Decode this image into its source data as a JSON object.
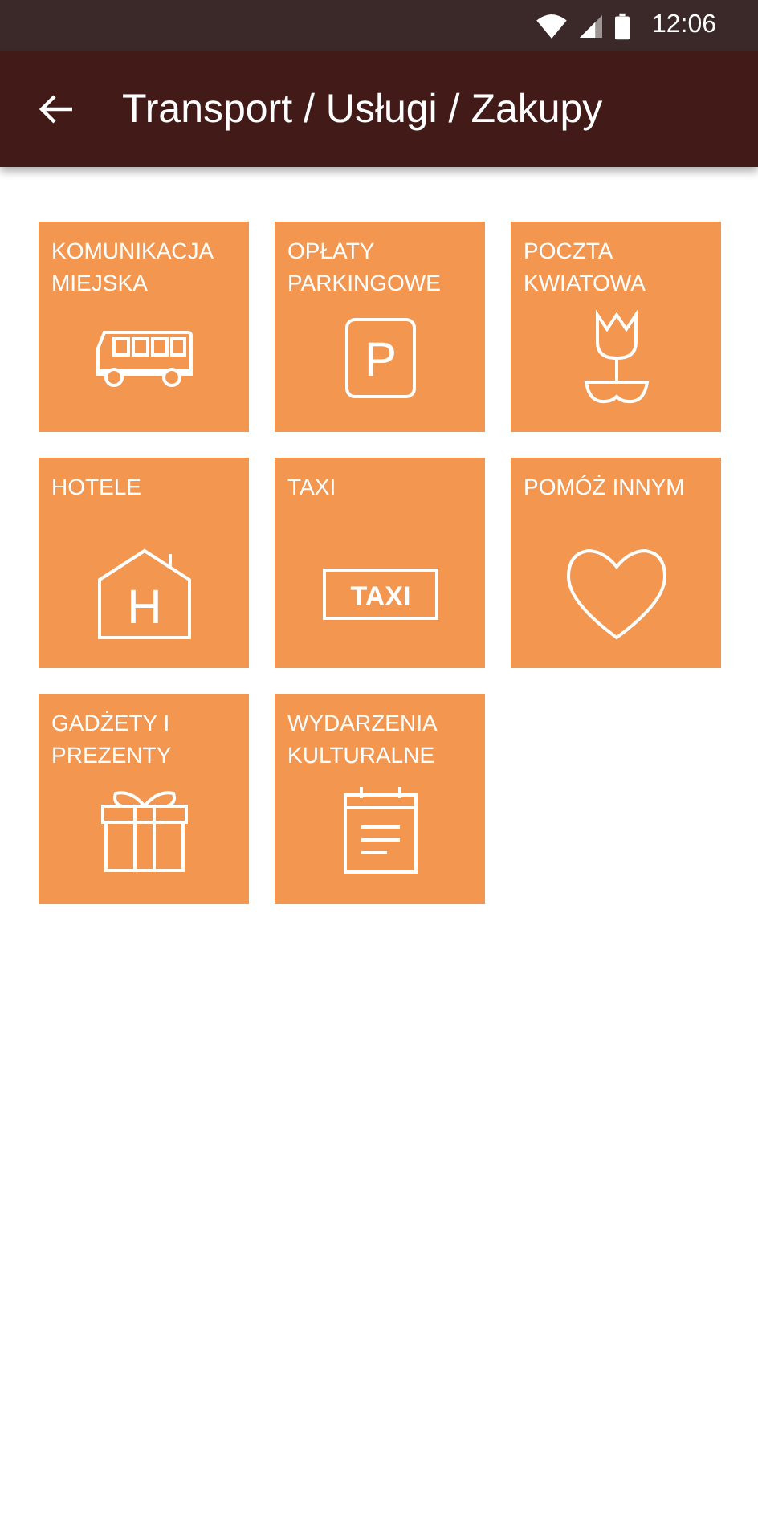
{
  "status_bar": {
    "time": "12:06"
  },
  "app_bar": {
    "title": "Transport / Usługi / Zakupy"
  },
  "tiles": [
    {
      "label": "KOMUNIKACJA MIEJSKA"
    },
    {
      "label": "OPŁATY PARKINGOWE",
      "icon_text": "P"
    },
    {
      "label": "POCZTA KWIATOWA"
    },
    {
      "label": "HOTELE",
      "icon_text": "H"
    },
    {
      "label": "TAXI",
      "icon_text": "TAXI"
    },
    {
      "label": "POMÓŻ INNYM"
    },
    {
      "label": "GADŻETY I PREZENTY"
    },
    {
      "label": "WYDARZENIA KULTURALNE"
    }
  ]
}
